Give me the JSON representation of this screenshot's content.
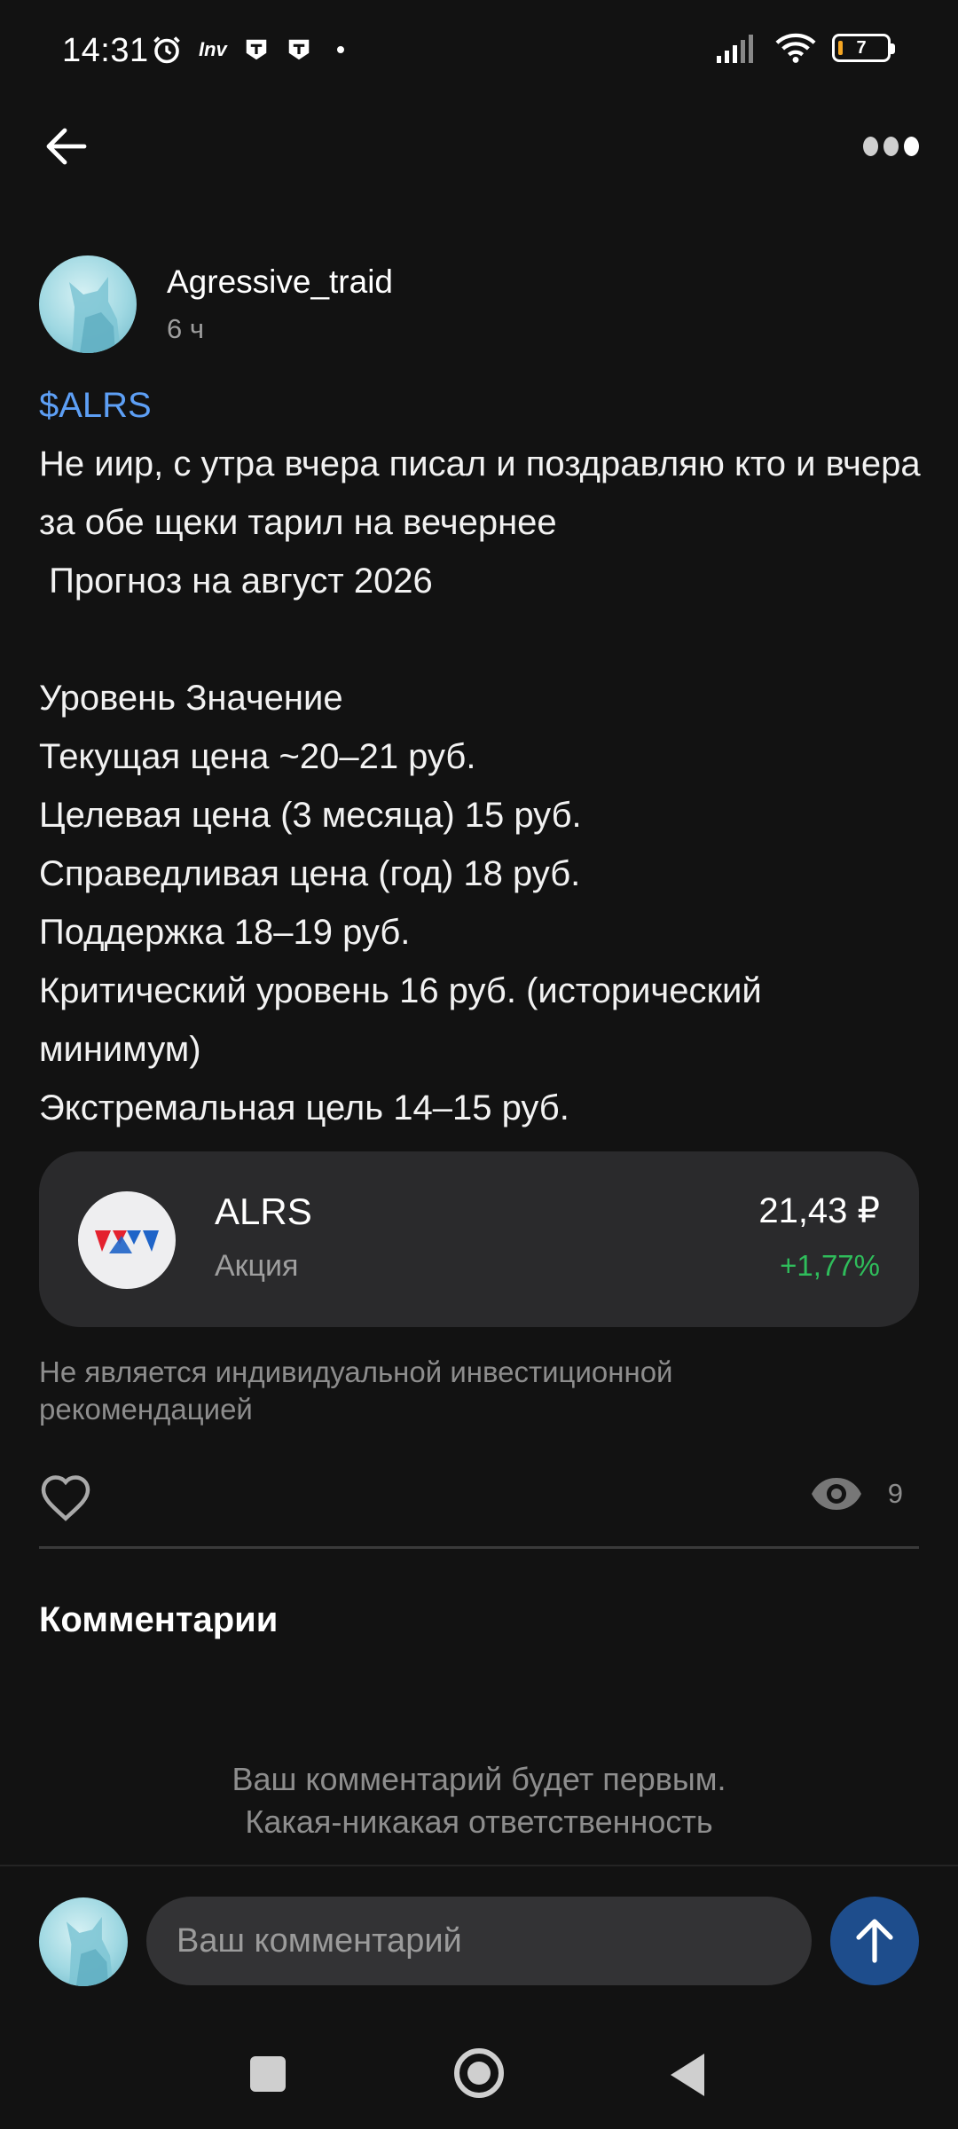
{
  "status_bar": {
    "time": "14:31",
    "inv_label": "Inv",
    "battery_level": "7"
  },
  "author": {
    "name": "Agressive_traid",
    "time_ago": "6 ч"
  },
  "post": {
    "ticker": "$ALRS",
    "body": "Не иир, с утра вчера писал и поздравляю кто и вчера за обе щеки тарил на вечернее\n Прогноз на август 2026\n\nУровень Значение\nТекущая цена ~20–21 руб.\nЦелевая цена (3 месяца) 15 руб.\nСправедливая цена (год) 18 руб.\nПоддержка 18–19 руб.\nКритический уровень 16 руб. (исторический минимум)\nЭкстремальная цель 14–15 руб."
  },
  "instrument_card": {
    "ticker": "ALRS",
    "type": "Акция",
    "price": "21,43 ₽",
    "change": "+1,77%",
    "change_color": "#2fbd5b"
  },
  "disclaimer": "Не является индивидуальной инвестиционной рекомендацией",
  "stats": {
    "views": "9"
  },
  "comments": {
    "title": "Комментарии",
    "empty_line1": "Ваш комментарий будет первым.",
    "empty_line2": "Какая-никакая ответственность",
    "input_placeholder": "Ваш комментарий"
  },
  "colors": {
    "background": "#121212",
    "card": "#2a2a2c",
    "ticker_link": "#5d9ff5",
    "send_button": "#1e4d8c"
  },
  "icons": {
    "back": "arrow-left-icon",
    "more": "more-dots-icon",
    "like": "heart-icon",
    "views": "eye-icon",
    "send": "arrow-up-icon"
  }
}
